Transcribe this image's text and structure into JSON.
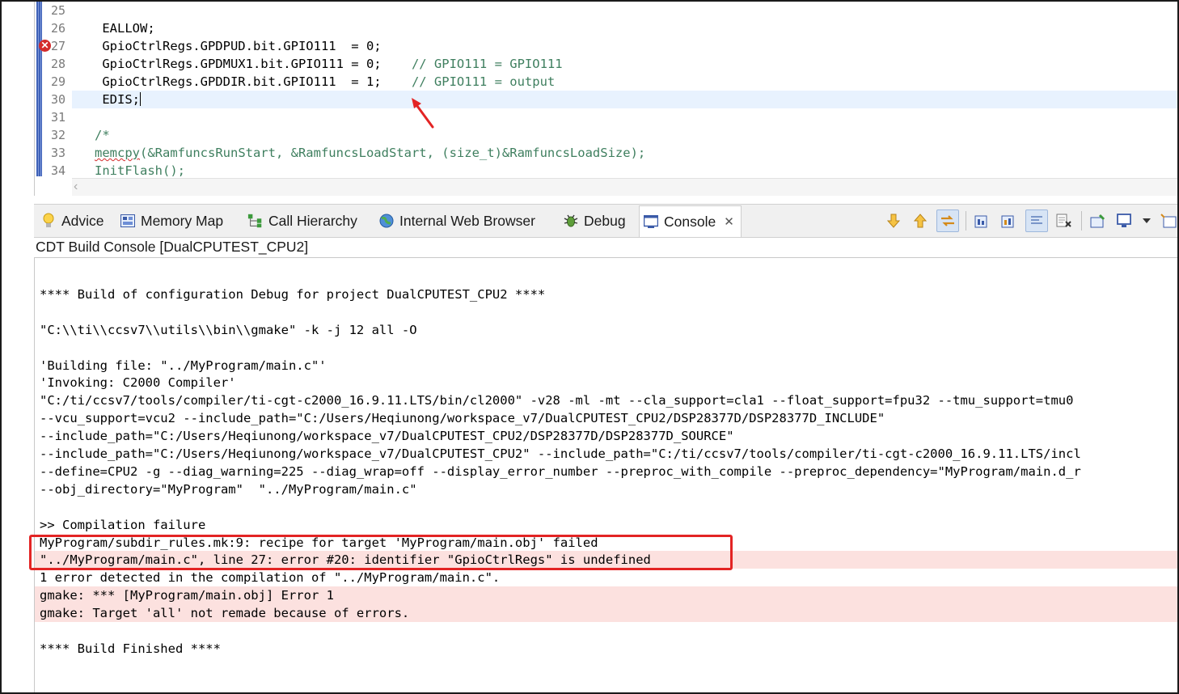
{
  "editor": {
    "lines": [
      {
        "no": "25",
        "code": "",
        "comment": ""
      },
      {
        "no": "26",
        "code": "    EALLOW;",
        "comment": ""
      },
      {
        "no": "27",
        "code": "    GpioCtrlRegs.GPDPUD.bit.GPIO111  = 0;",
        "comment": ""
      },
      {
        "no": "28",
        "code": "    GpioCtrlRegs.GPDMUX1.bit.GPIO111 = 0;    ",
        "comment": "// GPIO111 = GPIO111"
      },
      {
        "no": "29",
        "code": "    GpioCtrlRegs.GPDDIR.bit.GPIO111  = 1;    ",
        "comment": "// GPIO111 = output"
      },
      {
        "no": "30",
        "code": "    EDIS;",
        "comment": ""
      },
      {
        "no": "31",
        "code": "",
        "comment": ""
      },
      {
        "no": "32",
        "code": "   /*",
        "comment": ""
      },
      {
        "no": "33",
        "code_squiggle": "memcpy",
        "code": "(&RamfuncsRunStart, &RamfuncsLoadStart, (size_t)&RamfuncsLoadSize);",
        "comment": ""
      },
      {
        "no": "34",
        "code": "   InitFlash();",
        "comment": ""
      }
    ]
  },
  "tabs": [
    {
      "label": "Advice",
      "icon": "lightbulb-icon"
    },
    {
      "label": "Memory Map",
      "icon": "memory-map-icon"
    },
    {
      "label": "Call Hierarchy",
      "icon": "call-hierarchy-icon"
    },
    {
      "label": "Internal Web Browser",
      "icon": "globe-icon"
    },
    {
      "label": "Debug",
      "icon": "bug-icon"
    },
    {
      "label": "Console",
      "icon": "console-icon"
    }
  ],
  "console": {
    "title": "CDT Build Console [DualCPUTEST_CPU2]",
    "lines": [
      {
        "text": "",
        "error": false
      },
      {
        "text": "**** Build of configuration Debug for project DualCPUTEST_CPU2 ****",
        "error": false
      },
      {
        "text": "",
        "error": false
      },
      {
        "text": "\"C:\\\\ti\\\\ccsv7\\\\utils\\\\bin\\\\gmake\" -k -j 12 all -O",
        "error": false
      },
      {
        "text": "",
        "error": false
      },
      {
        "text": "'Building file: \"../MyProgram/main.c\"'",
        "error": false
      },
      {
        "text": "'Invoking: C2000 Compiler'",
        "error": false
      },
      {
        "text": "\"C:/ti/ccsv7/tools/compiler/ti-cgt-c2000_16.9.11.LTS/bin/cl2000\" -v28 -ml -mt --cla_support=cla1 --float_support=fpu32 --tmu_support=tmu0",
        "error": false
      },
      {
        "text": "--vcu_support=vcu2 --include_path=\"C:/Users/Heqiunong/workspace_v7/DualCPUTEST_CPU2/DSP28377D/DSP28377D_INCLUDE\"",
        "error": false
      },
      {
        "text": "--include_path=\"C:/Users/Heqiunong/workspace_v7/DualCPUTEST_CPU2/DSP28377D/DSP28377D_SOURCE\"",
        "error": false
      },
      {
        "text": "--include_path=\"C:/Users/Heqiunong/workspace_v7/DualCPUTEST_CPU2\" --include_path=\"C:/ti/ccsv7/tools/compiler/ti-cgt-c2000_16.9.11.LTS/incl",
        "error": false
      },
      {
        "text": "--define=CPU2 -g --diag_warning=225 --diag_wrap=off --display_error_number --preproc_with_compile --preproc_dependency=\"MyProgram/main.d_r",
        "error": false
      },
      {
        "text": "--obj_directory=\"MyProgram\"  \"../MyProgram/main.c\"",
        "error": false
      },
      {
        "text": "",
        "error": false
      },
      {
        "text": ">> Compilation failure",
        "error": false
      },
      {
        "text": "MyProgram/subdir_rules.mk:9: recipe for target 'MyProgram/main.obj' failed",
        "error": false
      },
      {
        "text": "\"../MyProgram/main.c\", line 27: error #20: identifier \"GpioCtrlRegs\" is undefined",
        "error": true
      },
      {
        "text": "1 error detected in the compilation of \"../MyProgram/main.c\".",
        "error": false
      },
      {
        "text": "gmake: *** [MyProgram/main.obj] Error 1",
        "error": true
      },
      {
        "text": "gmake: Target 'all' not remade because of errors.",
        "error": true
      },
      {
        "text": "",
        "error": false
      },
      {
        "text": "**** Build Finished ****",
        "error": false
      }
    ]
  },
  "colors": {
    "error_bg": "#fce1df",
    "annotation": "#e32424",
    "comment": "#3f7f5f"
  }
}
